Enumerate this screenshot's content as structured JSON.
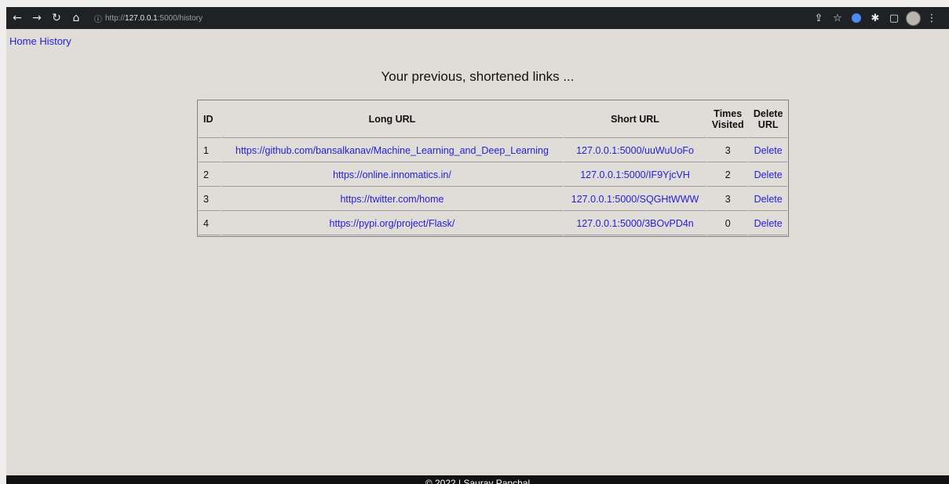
{
  "browser": {
    "url_prefix": "http://",
    "url_host": "127.0.0.1",
    "url_rest": ":5000/history"
  },
  "nav": {
    "home": "Home",
    "history": "History"
  },
  "page_title": "Your previous, shortened links ...",
  "table": {
    "headers": {
      "id": "ID",
      "long_url": "Long URL",
      "short_url": "Short URL",
      "times_visited_1": "Times",
      "times_visited_2": "Visited",
      "delete_1": "Delete",
      "delete_2": "URL"
    },
    "rows": [
      {
        "id": "1",
        "long_url": "https://github.com/bansalkanav/Machine_Learning_and_Deep_Learning",
        "short_url": "127.0.0.1:5000/uuWuUoFo",
        "visits": "3",
        "delete": "Delete"
      },
      {
        "id": "2",
        "long_url": "https://online.innomatics.in/",
        "short_url": "127.0.0.1:5000/IF9YjcVH",
        "visits": "2",
        "delete": "Delete"
      },
      {
        "id": "3",
        "long_url": "https://twitter.com/home",
        "short_url": "127.0.0.1:5000/SQGHtWWW",
        "visits": "3",
        "delete": "Delete"
      },
      {
        "id": "4",
        "long_url": "https://pypi.org/project/Flask/",
        "short_url": "127.0.0.1:5000/3BOvPD4n",
        "visits": "0",
        "delete": "Delete"
      }
    ]
  },
  "footer": "© 2022 | Saurav Panchal",
  "colors": {
    "link": "#2222dd",
    "page_bg": "#e0dcd8",
    "chrome_bg": "#202124",
    "footer_bg": "#111111"
  }
}
